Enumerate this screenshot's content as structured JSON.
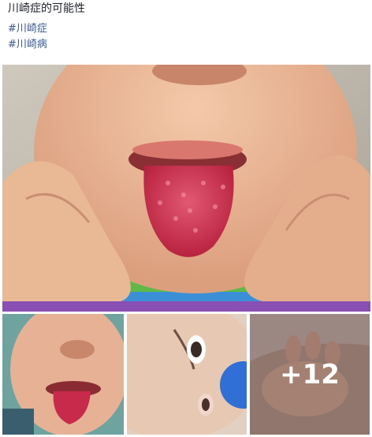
{
  "post": {
    "caption": "川崎症的可能性",
    "hashtags": [
      "#川崎症",
      "#川崎病"
    ]
  },
  "gallery": {
    "more_label": "+12"
  },
  "colors": {
    "hashtag": "#385898",
    "text": "#1d2129"
  }
}
